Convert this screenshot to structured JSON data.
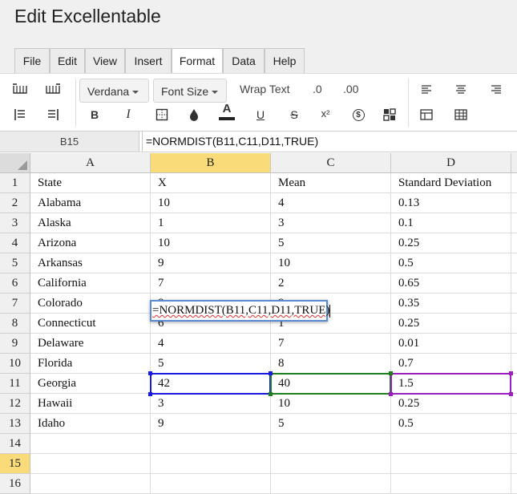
{
  "app": {
    "title": "Edit Excellentable"
  },
  "tabs": [
    {
      "label": "File"
    },
    {
      "label": "Edit"
    },
    {
      "label": "View"
    },
    {
      "label": "Insert"
    },
    {
      "label": "Format",
      "active": true
    },
    {
      "label": "Data"
    },
    {
      "label": "Help"
    }
  ],
  "toolbar": {
    "font_family": "Verdana",
    "font_size": "Font Size",
    "wrap_text": "Wrap Text",
    "decrease_decimal": ".0",
    "increase_decimal": ".00",
    "bold": "B",
    "italic": "I",
    "underline": "U",
    "strikethrough": "S",
    "superscript": "x²",
    "text_color": "A",
    "currency": "$"
  },
  "formula_bar": {
    "cell_ref": "B15",
    "formula": "=NORMDIST(B11,C11,D11,TRUE)"
  },
  "columns": [
    "A",
    "B",
    "C",
    "D"
  ],
  "selected_column": "B",
  "selected_row": "15",
  "rows": [
    {
      "n": "1",
      "cells": [
        "State",
        "X",
        "Mean",
        "Standard Deviation"
      ]
    },
    {
      "n": "2",
      "cells": [
        "Alabama",
        "10",
        "4",
        "0.13"
      ]
    },
    {
      "n": "3",
      "cells": [
        "Alaska",
        "1",
        "3",
        "0.1"
      ]
    },
    {
      "n": "4",
      "cells": [
        "Arizona",
        "10",
        "5",
        "0.25"
      ]
    },
    {
      "n": "5",
      "cells": [
        "Arkansas",
        "9",
        "10",
        "0.5"
      ]
    },
    {
      "n": "6",
      "cells": [
        "California",
        "7",
        "2",
        "0.65"
      ]
    },
    {
      "n": "7",
      "cells": [
        "Colorado",
        "8",
        "9",
        "0.35"
      ]
    },
    {
      "n": "8",
      "cells": [
        "Connecticut",
        "6",
        "1",
        "0.25"
      ]
    },
    {
      "n": "9",
      "cells": [
        "Delaware",
        "4",
        "7",
        "0.01"
      ]
    },
    {
      "n": "10",
      "cells": [
        "Florida",
        "5",
        "8",
        "0.7"
      ]
    },
    {
      "n": "11",
      "cells": [
        "Georgia",
        "42",
        "40",
        "1.5"
      ]
    },
    {
      "n": "12",
      "cells": [
        "Hawaii",
        "3",
        "10",
        "0.25"
      ]
    },
    {
      "n": "13",
      "cells": [
        "Idaho",
        "9",
        "5",
        "0.5"
      ]
    },
    {
      "n": "14",
      "cells": [
        "",
        "",
        "",
        ""
      ]
    },
    {
      "n": "15",
      "cells": [
        "",
        "",
        "",
        ""
      ]
    },
    {
      "n": "16",
      "cells": [
        "",
        "",
        "",
        ""
      ]
    }
  ],
  "editor": {
    "prefix": "=NORMDIST(",
    "b": "B11",
    "c": "C11",
    "d": "D11",
    "suffix": ",TRUE)"
  },
  "colors": {
    "ref_b": "#1a1adf",
    "ref_c": "#1f7f1f",
    "ref_d": "#9b1fbf",
    "selected_header": "#f9dc79"
  }
}
